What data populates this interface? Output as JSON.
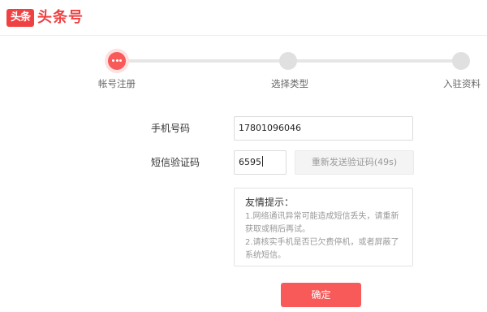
{
  "header": {
    "logo_badge": "头条",
    "logo_text": "头条号"
  },
  "steps": [
    {
      "label": "帐号注册",
      "state": "active"
    },
    {
      "label": "选择类型",
      "state": "pending"
    },
    {
      "label": "入驻资料",
      "state": "pending"
    }
  ],
  "form": {
    "phone_label": "手机号码",
    "phone_value": "17801096046",
    "sms_label": "短信验证码",
    "sms_value": "6595",
    "resend_label": "重新发送验证码(49s)"
  },
  "tips": {
    "title": "友情提示：",
    "lines": [
      "1.网络通讯异常可能造成短信丢失，请重新",
      "获取或稍后再试。",
      "2.请核实手机是否已欠费停机，或者屏蔽了",
      "系统短信。"
    ]
  },
  "confirm_label": "确定",
  "colors": {
    "brand": "#f04142",
    "accent": "#f85959",
    "inactive": "#e0e0e0"
  }
}
